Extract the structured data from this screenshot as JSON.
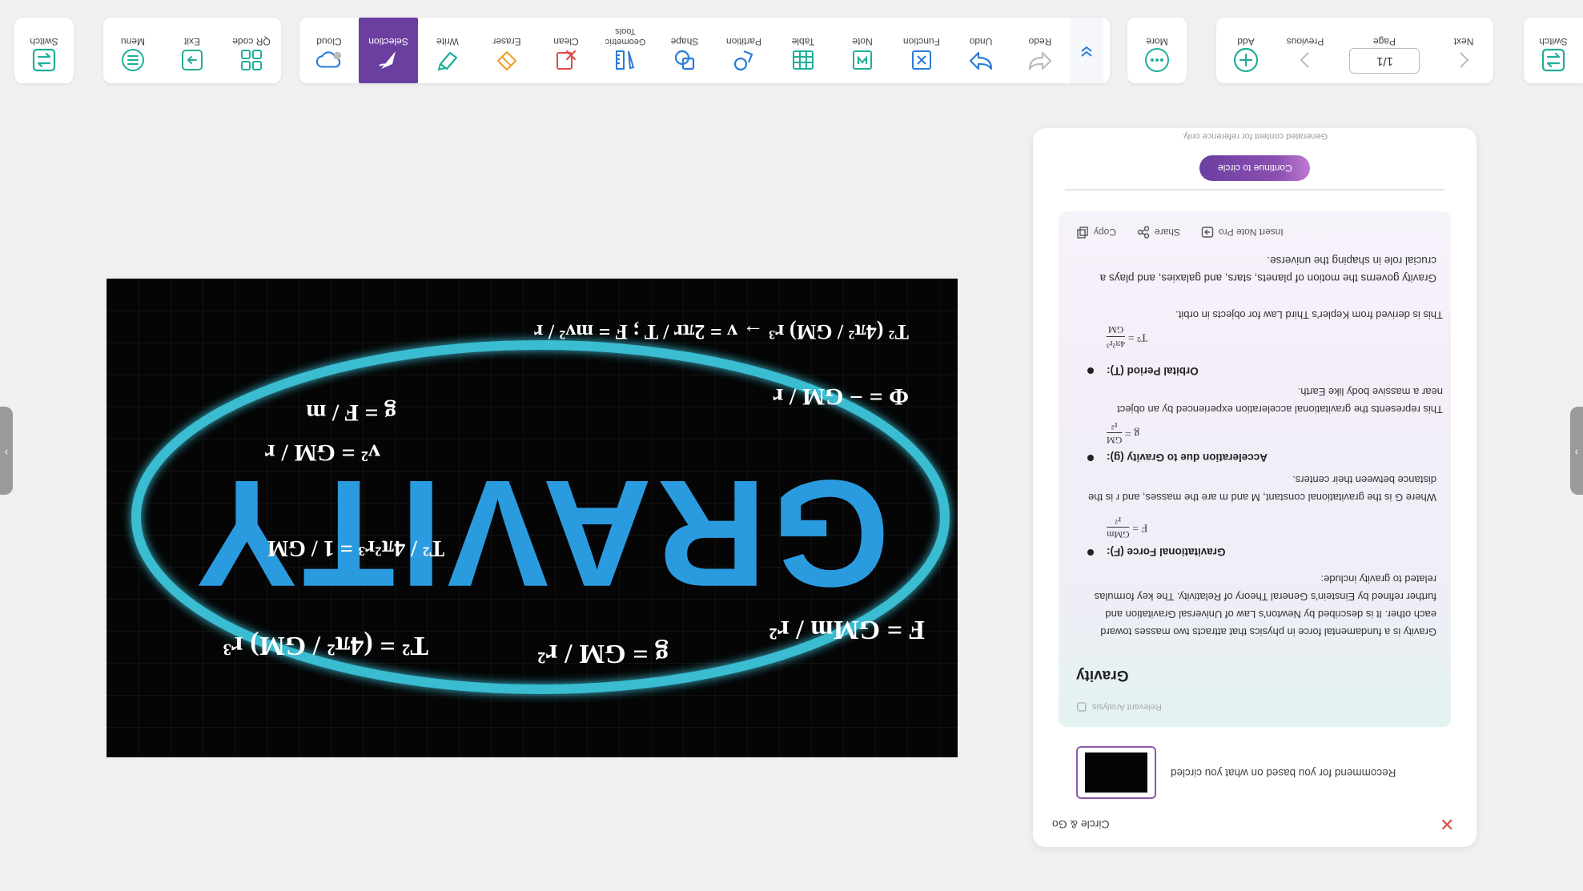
{
  "toolbar": {
    "switch_left": "Switch",
    "menu": "Menu",
    "exit": "Exit",
    "qr": "QR code",
    "cloud": "Cloud",
    "selection": "Selection",
    "write": "Write",
    "eraser": "Eraser",
    "clean": "Clean",
    "geometric": "Geometric Tools",
    "shape": "Shape",
    "partition": "Partition",
    "table": "Table",
    "note": "Note",
    "function": "Function",
    "undo": "Undo",
    "redo": "Redo",
    "more": "More",
    "add": "Add",
    "previous": "Previous",
    "page_label": "Page",
    "page_value": "1/1",
    "next": "Next",
    "switch_right": "Switch"
  },
  "colors": {
    "accent": "#6b3fa0",
    "teal_icon": "#1fae98",
    "orange_icon": "#f0a02a",
    "red_icon": "#e04b4b",
    "blue_icon": "#2a7bd8"
  },
  "board": {
    "word": "GRAVITY",
    "formulas": [
      "F = GMm / r²",
      "g = GM / r²",
      "T² = (4π² / GM) r³",
      "T² / 4π²r³ = 1 / GM",
      "v² = GM / r",
      "g = F / m",
      "T² (4π² / GM) r³ → v = 2πr / T ; F = mv² / r",
      "Φ = − GM / r"
    ]
  },
  "panel": {
    "disclaimer": "Generated content for reference only.",
    "continue": "Continue to circle",
    "actions": {
      "copy": "Copy",
      "share": "Share",
      "insert": "Insert Note Pro"
    },
    "content": {
      "closing": "Gravity governs the motion of planets, stars, and galaxies, and plays a crucial role in shaping the universe.",
      "kepler_note": "This is derived from Kepler's Third Law for objects in orbit.",
      "orbital_title": "Orbital Period (T):",
      "accel_note": "This represents the gravitational acceleration experienced by an object near a massive body like Earth.",
      "accel_title": "Acceleration due to Gravity (g):",
      "where_note": "Where G is the gravitational constant, M and m are the masses, and r is the distance between their centers.",
      "force_title": "Gravitational Force (F):",
      "intro": "Gravity is a fundamental force in physics that attracts two masses toward each other. It is described by Newton's Law of Universal Gravitation and further refined by Einstein's General Theory of Relativity. The key formulas related to gravity include:",
      "title": "Gravity",
      "relevant": "Relevant Analysis"
    },
    "recommend": "Recommend for you based on what you circled",
    "circle_go": "Circle & Go"
  }
}
